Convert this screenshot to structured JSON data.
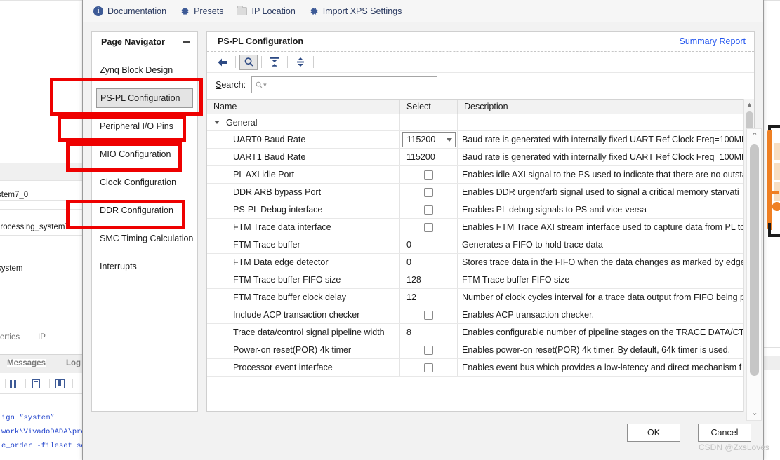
{
  "background": {
    "tree_labels": [
      "stem7_0",
      "processing_system7",
      "system"
    ],
    "tabs": [
      "erties",
      "IP"
    ],
    "panel_tabs": [
      "Messages",
      "Log"
    ],
    "panel_icons": [
      "pause-icon",
      "document-icon",
      "grid-icon"
    ],
    "console_lines": [
      "ign “system”",
      "work\\VivadoDADA\\pro",
      "e_order -fileset so"
    ]
  },
  "topbar": {
    "items": [
      {
        "label": "Documentation",
        "icon": "info-icon"
      },
      {
        "label": "Presets",
        "icon": "gear-icon"
      },
      {
        "label": "IP Location",
        "icon": "folder-icon"
      },
      {
        "label": "Import XPS Settings",
        "icon": "gear-icon"
      }
    ]
  },
  "navigator": {
    "title": "Page Navigator",
    "minimize_icon": "minimize-icon",
    "items": [
      {
        "label": "Zynq Block Design",
        "selected": false
      },
      {
        "label": "PS-PL Configuration",
        "selected": true
      },
      {
        "label": "Peripheral I/O Pins",
        "selected": false
      },
      {
        "label": "MIO Configuration",
        "selected": false
      },
      {
        "label": "Clock Configuration",
        "selected": false
      },
      {
        "label": "DDR Configuration",
        "selected": false
      },
      {
        "label": "SMC Timing Calculation",
        "selected": false
      },
      {
        "label": "Interrupts",
        "selected": false
      }
    ]
  },
  "content": {
    "title": "PS-PL Configuration",
    "summary_link": "Summary Report",
    "toolbar": [
      {
        "name": "back-arrow-icon",
        "active": false
      },
      {
        "name": "search-icon",
        "active": true
      },
      {
        "name": "collapse-all-icon",
        "active": false
      },
      {
        "name": "expand-all-icon",
        "active": false
      }
    ],
    "search": {
      "label": "Search:",
      "value": "",
      "placeholder": "Q-"
    },
    "table": {
      "columns": [
        "Name",
        "Select",
        "Description"
      ],
      "rows": [
        {
          "type": "group",
          "name": "General",
          "select": "",
          "description": "",
          "expanded": true
        },
        {
          "type": "combo",
          "name": "UART0 Baud Rate",
          "select": "115200",
          "description": "Baud rate is generated with internally fixed UART Ref Clock Freq=100MH"
        },
        {
          "type": "value",
          "name": "UART1 Baud Rate",
          "select": "115200",
          "description": "Baud rate is generated with internally fixed UART Ref Clock Freq=100MH"
        },
        {
          "type": "checkbox",
          "name": "PL AXI idle Port",
          "checked": false,
          "description": "Enables idle AXI signal to the PS used to indicate that there are no outsta"
        },
        {
          "type": "checkbox",
          "name": "DDR ARB bypass Port",
          "checked": false,
          "description": "Enables DDR urgent/arb signal used to signal a critical memory starvati"
        },
        {
          "type": "checkbox",
          "name": "PS-PL Debug interface",
          "checked": false,
          "description": "Enables PL debug signals to PS and vice-versa"
        },
        {
          "type": "checkbox",
          "name": "FTM Trace data interface",
          "checked": false,
          "description": "Enables FTM Trace AXI stream interface used to capture data from PL to"
        },
        {
          "type": "value",
          "name": "FTM Trace buffer",
          "select": "0",
          "description": "Generates a FIFO to hold trace data"
        },
        {
          "type": "value",
          "name": "FTM Data edge detector",
          "select": "0",
          "description": "Stores trace data in the FIFO when the data changes as marked by edge"
        },
        {
          "type": "value",
          "name": "FTM Trace buffer FIFO size",
          "select": "128",
          "description": "FTM Trace buffer FIFO size"
        },
        {
          "type": "value",
          "name": "FTM Trace buffer clock delay",
          "select": "12",
          "description": "Number of clock cycles interval for a trace data output from FIFO being pr"
        },
        {
          "type": "checkbox",
          "name": "Include ACP transaction checker",
          "checked": false,
          "description": " Enables ACP transaction checker."
        },
        {
          "type": "value",
          "name": "Trace data/control signal pipeline width",
          "select": "8",
          "description": "Enables configurable number of pipeline stages on the TRACE DATA/CT"
        },
        {
          "type": "checkbox",
          "name": "Power-on reset(POR) 4k timer",
          "checked": false,
          "description": "Enables power-on reset(POR) 4k timer. By default, 64k timer is used."
        },
        {
          "type": "checkbox",
          "name": "Processor event interface",
          "checked": false,
          "description": "Enables event bus which provides a low-latency and direct mechanism f"
        }
      ]
    }
  },
  "footer": {
    "ok_label": "OK",
    "cancel_label": "Cancel"
  },
  "watermark": "CSDN @ZxsLoves",
  "annotations": {
    "color": "#ee0000",
    "boxes": [
      {
        "target": "PS-PL Configuration"
      },
      {
        "target": "Peripheral I/O Pins"
      },
      {
        "target": "MIO Configuration"
      },
      {
        "target": "DDR Configuration"
      }
    ]
  }
}
